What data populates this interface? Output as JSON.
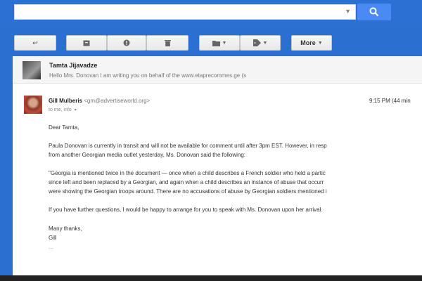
{
  "search": {
    "placeholder": "",
    "value": ""
  },
  "toolbar": {
    "more_label": "More"
  },
  "thread": {
    "sender": "Tamta Jijavadze",
    "snippet": "Hello Mrs. Donovan I am writing you on behalf of the www.etaprecommes.ge (s"
  },
  "message": {
    "sender_name": "Gill Mulberis",
    "sender_email": "<gm@advertiseworld.org>",
    "to_line": "to me, info",
    "time": "9:15 PM (44 min",
    "greeting": "Dear Tamta,",
    "para1_line1": "Paula Donovan is currently in transit and will not be available for comment until after 3pm EST. However, in resp",
    "para1_line2": "from another Georgian media outlet yesterday, Ms. Donovan said the following:",
    "para2_line1": "\"Georgia is mentioned twice in the document — once when a child describes a French soldier who held a partic",
    "para2_line2": "since left and been replaced by a Georgian, and again when a child describes an instance of abuse that occurr",
    "para2_line3": "were showing the Georgian troops around. There are no accusations of abuse by Georgian soldiers mentioned i",
    "para3": "If you have further questions, I would be happy to arrange for you to speak with Ms. Donovan upon her arrival.",
    "closing": "Many thanks,",
    "signoff": "Gill",
    "signature_mark": "---"
  }
}
